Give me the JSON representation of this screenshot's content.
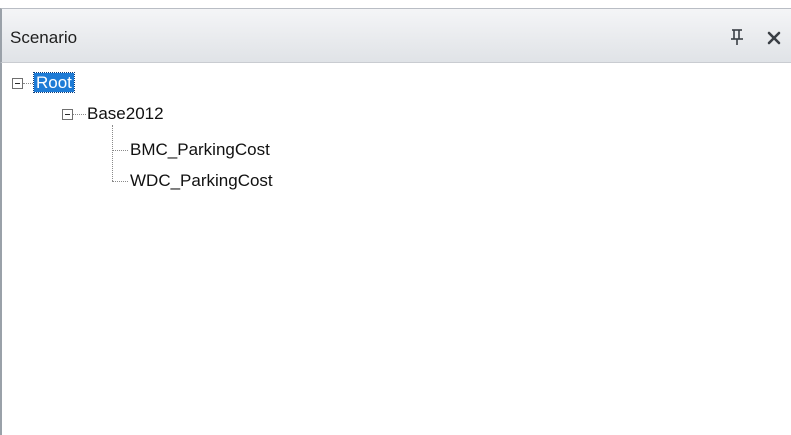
{
  "panel": {
    "title": "Scenario",
    "pin_icon": "pin-icon",
    "close_icon": "close-icon"
  },
  "tree": {
    "root": {
      "label": "Root",
      "selected": true,
      "expanded": true
    },
    "base": {
      "label": "Base2012",
      "expanded": true
    },
    "children": [
      {
        "label": "BMC_ParkingCost"
      },
      {
        "label": "WDC_ParkingCost"
      }
    ]
  },
  "colors": {
    "selection": "#1d7bd6",
    "titlebar": "#e9ebee",
    "border": "#9aa1a9"
  }
}
